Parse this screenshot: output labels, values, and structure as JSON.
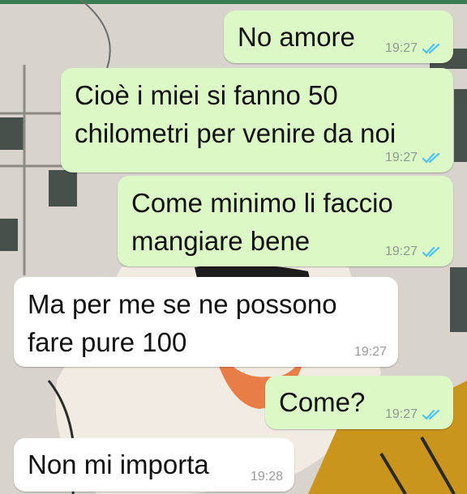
{
  "colors": {
    "outgoing_bubble": "#dcf8c6",
    "incoming_bubble": "#ffffff",
    "read_ticks": "#4fc3f7",
    "timestamp_text": "#8c9a8c"
  },
  "messages": [
    {
      "direction": "outgoing",
      "lines": [
        "No amore"
      ],
      "time": "19:27",
      "status_icon": "double-check-read-icon"
    },
    {
      "direction": "outgoing",
      "lines": [
        "Cioè i miei si fanno 50",
        "chilometri per venire da noi"
      ],
      "time": "19:27",
      "status_icon": "double-check-read-icon"
    },
    {
      "direction": "outgoing",
      "lines": [
        "Come minimo li faccio",
        "mangiare bene"
      ],
      "time": "19:27",
      "status_icon": "double-check-read-icon"
    },
    {
      "direction": "incoming",
      "lines": [
        "Ma per me se ne possono",
        "fare pure 100"
      ],
      "time": "19:27"
    },
    {
      "direction": "outgoing",
      "lines": [
        "Come?"
      ],
      "time": "19:27",
      "status_icon": "double-check-read-icon"
    },
    {
      "direction": "incoming",
      "lines": [
        "Non mi importa"
      ],
      "time": "19:28"
    }
  ]
}
